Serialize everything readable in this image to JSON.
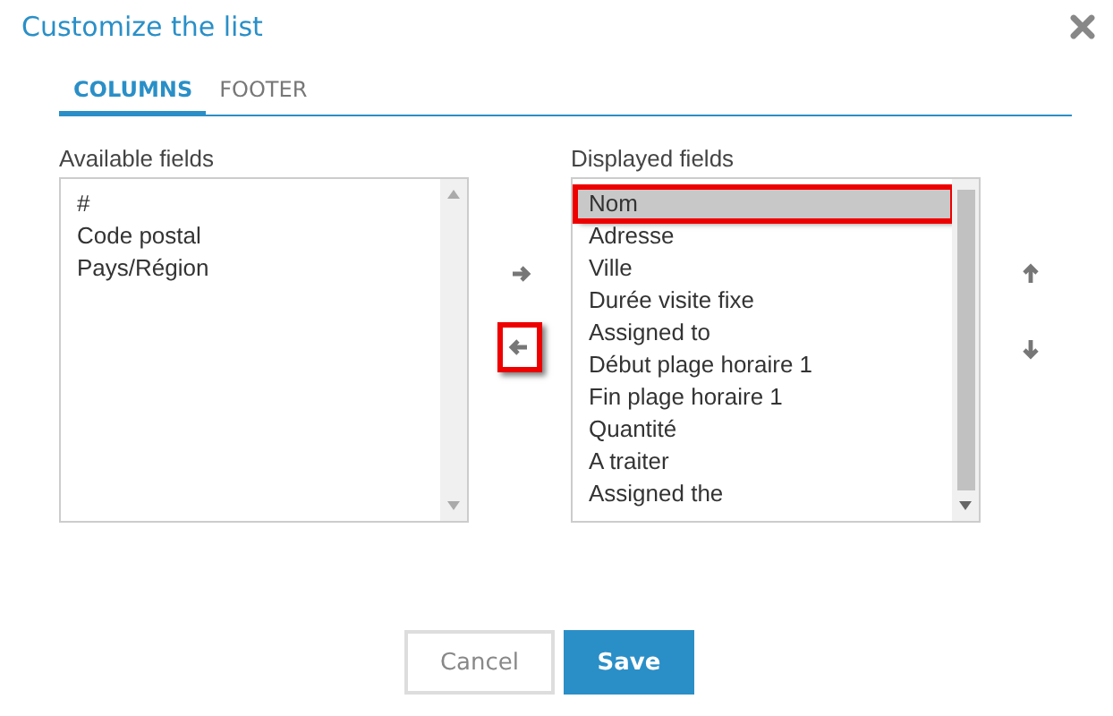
{
  "window": {
    "title": "Customize the list"
  },
  "tabs": [
    {
      "label": "COLUMNS",
      "selected": true
    },
    {
      "label": "FOOTER",
      "selected": false
    }
  ],
  "available": {
    "label": "Available fields",
    "items": [
      {
        "label": "#",
        "selected": false
      },
      {
        "label": "Code postal",
        "selected": false
      },
      {
        "label": "Pays/Région",
        "selected": false
      }
    ]
  },
  "transfer_buttons": [
    {
      "kind": "right",
      "annotated": false
    },
    {
      "kind": "left",
      "annotated": true
    }
  ],
  "displayed": {
    "label": "Displayed fields",
    "items": [
      {
        "label": "Nom",
        "selected": true,
        "annotated": true
      },
      {
        "label": "Adresse",
        "selected": false,
        "annotated": false
      },
      {
        "label": "Ville",
        "selected": false,
        "annotated": false
      },
      {
        "label": "Durée visite fixe",
        "selected": false,
        "annotated": false
      },
      {
        "label": "Assigned to",
        "selected": false,
        "annotated": false
      },
      {
        "label": "Début plage horaire 1",
        "selected": false,
        "annotated": false
      },
      {
        "label": "Fin plage horaire 1",
        "selected": false,
        "annotated": false
      },
      {
        "label": "Quantité",
        "selected": false,
        "annotated": false
      },
      {
        "label": "A traiter",
        "selected": false,
        "annotated": false
      },
      {
        "label": "Assigned the",
        "selected": false,
        "annotated": false
      }
    ]
  },
  "order_buttons": [
    {
      "kind": "up"
    },
    {
      "kind": "down"
    }
  ],
  "buttons": [
    {
      "label": "Cancel",
      "kind": "secondary"
    },
    {
      "label": "Save",
      "kind": "primary"
    }
  ]
}
